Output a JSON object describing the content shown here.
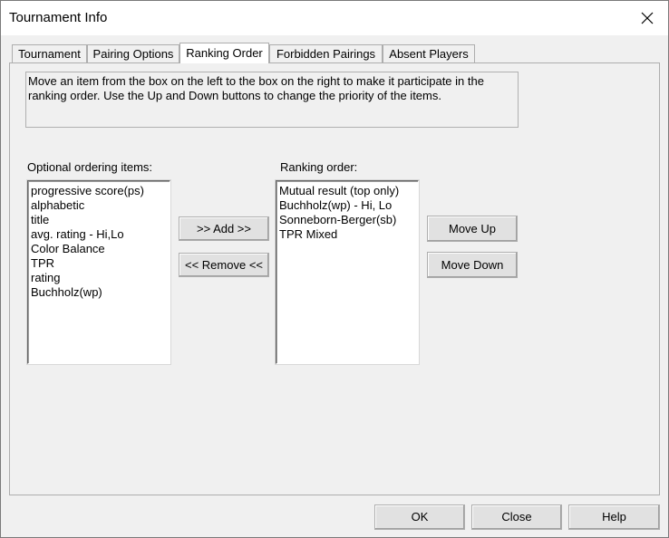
{
  "window": {
    "title": "Tournament Info"
  },
  "tabs": [
    {
      "label": "Tournament"
    },
    {
      "label": "Pairing Options"
    },
    {
      "label": "Ranking Order"
    },
    {
      "label": "Forbidden Pairings"
    },
    {
      "label": "Absent Players"
    }
  ],
  "active_tab": "Ranking Order",
  "info": {
    "line1": "Move an item from the box on the left to the box on the right to make it participate in the",
    "line2": "ranking order. Use the Up and Down buttons to change the priority of the items."
  },
  "optional": {
    "label": "Optional ordering items:",
    "items": [
      "progressive score(ps)",
      "alphabetic",
      "title",
      "avg. rating - Hi,Lo",
      "Color Balance",
      "TPR",
      "rating",
      "Buchholz(wp)"
    ]
  },
  "ranking": {
    "label": "Ranking order:",
    "items": [
      "Mutual result (top only)",
      "Buchholz(wp) - Hi, Lo",
      "Sonneborn-Berger(sb)",
      "TPR Mixed"
    ]
  },
  "buttons": {
    "add": ">> Add >>",
    "remove": "<< Remove <<",
    "move_up": "Move Up",
    "move_down": "Move Down",
    "ok": "OK",
    "close": "Close",
    "help": "Help"
  },
  "icons": {
    "close": "close-icon"
  }
}
